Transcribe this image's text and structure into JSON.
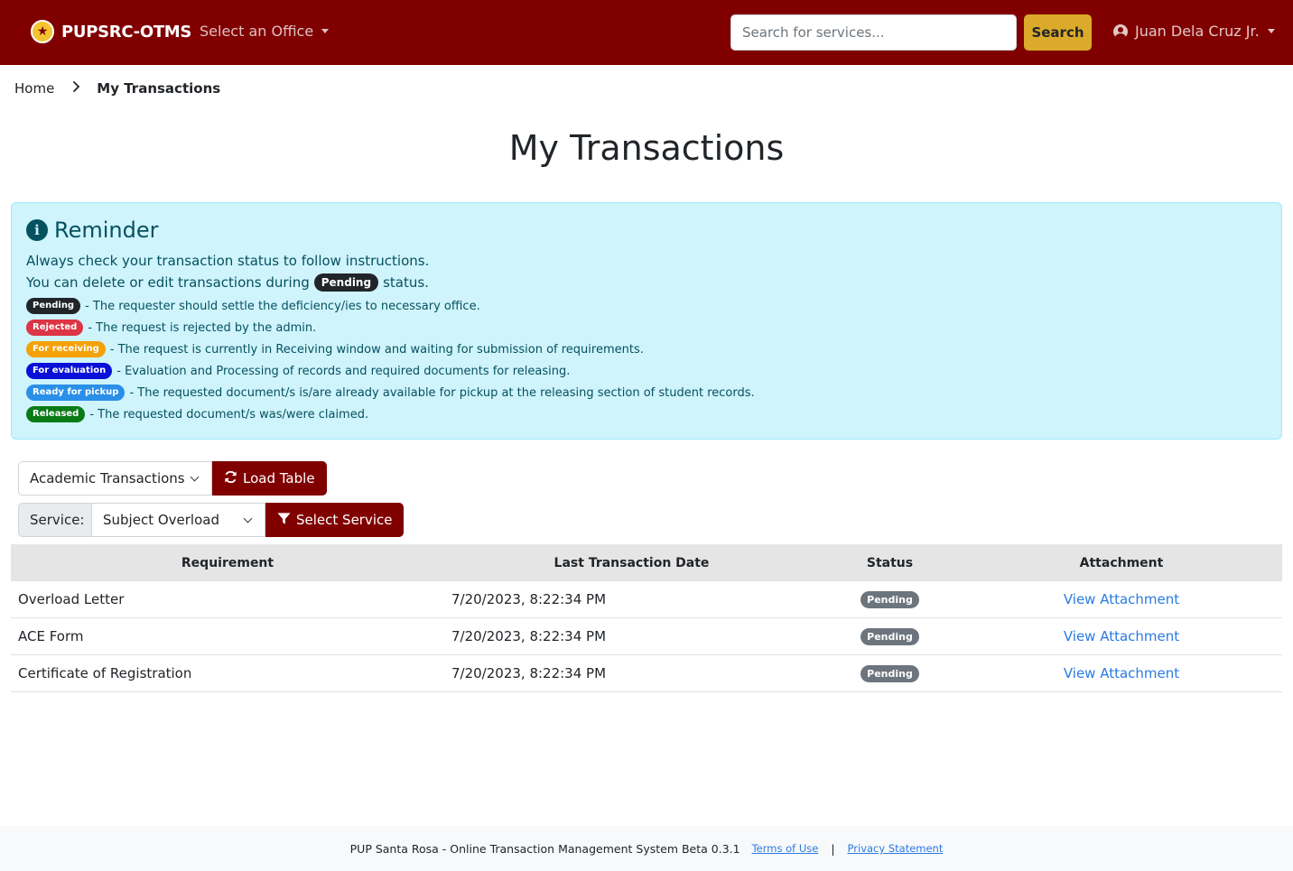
{
  "navbar": {
    "brand": "PUPSRC-OTMS",
    "office_dropdown": "Select an Office",
    "search_placeholder": "Search for services...",
    "search_button": "Search",
    "user_name": "Juan Dela Cruz Jr."
  },
  "breadcrumb": {
    "home": "Home",
    "current": "My Transactions"
  },
  "page_title": "My Transactions",
  "reminder": {
    "title": "Reminder",
    "line1": "Always check your transaction status to follow instructions.",
    "line2_pre": "You can delete or edit transactions during",
    "line2_badge": "Pending",
    "line2_post": "status.",
    "statuses": [
      {
        "badge": "Pending",
        "text": "- The requester should settle the deficiency/ies to necessary office.",
        "color": "#212529"
      },
      {
        "badge": "Rejected",
        "text": "- The request is rejected by the admin.",
        "color": "#dc3545"
      },
      {
        "badge": "For receiving",
        "text": "- The request is currently in Receiving window and waiting for submission of requirements.",
        "color": "#f4a10a"
      },
      {
        "badge": "For evaluation",
        "text": "- Evaluation and Processing of records and required documents for releasing.",
        "color": "#0a10d8"
      },
      {
        "badge": "Ready for pickup",
        "text": "- The requested document/s is/are already available for pickup at the releasing section of student records.",
        "color": "#2a8fe8"
      },
      {
        "badge": "Released",
        "text": "- The requested document/s was/were claimed.",
        "color": "#0a7a16"
      }
    ]
  },
  "controls": {
    "transaction_type": "Academic Transactions",
    "load_button": "Load Table",
    "service_label": "Service:",
    "service_value": "Subject Overload",
    "select_service_button": "Select Service"
  },
  "table": {
    "headers": [
      "Requirement",
      "Last Transaction Date",
      "Status",
      "Attachment"
    ],
    "rows": [
      {
        "requirement": "Overload Letter",
        "date": "7/20/2023, 8:22:34 PM",
        "status": "Pending",
        "attachment": "View Attachment"
      },
      {
        "requirement": "ACE Form",
        "date": "7/20/2023, 8:22:34 PM",
        "status": "Pending",
        "attachment": "View Attachment"
      },
      {
        "requirement": "Certificate of Registration",
        "date": "7/20/2023, 8:22:34 PM",
        "status": "Pending",
        "attachment": "View Attachment"
      }
    ]
  },
  "footer": {
    "text": "PUP Santa Rosa - Online Transaction Management System Beta 0.3.1",
    "terms": "Terms of Use",
    "separator": "|",
    "privacy": "Privacy Statement"
  },
  "colors": {
    "primary": "#800000",
    "accent": "#dcaa2a",
    "info_bg": "#cff4fc",
    "link": "#2a7ae2"
  }
}
